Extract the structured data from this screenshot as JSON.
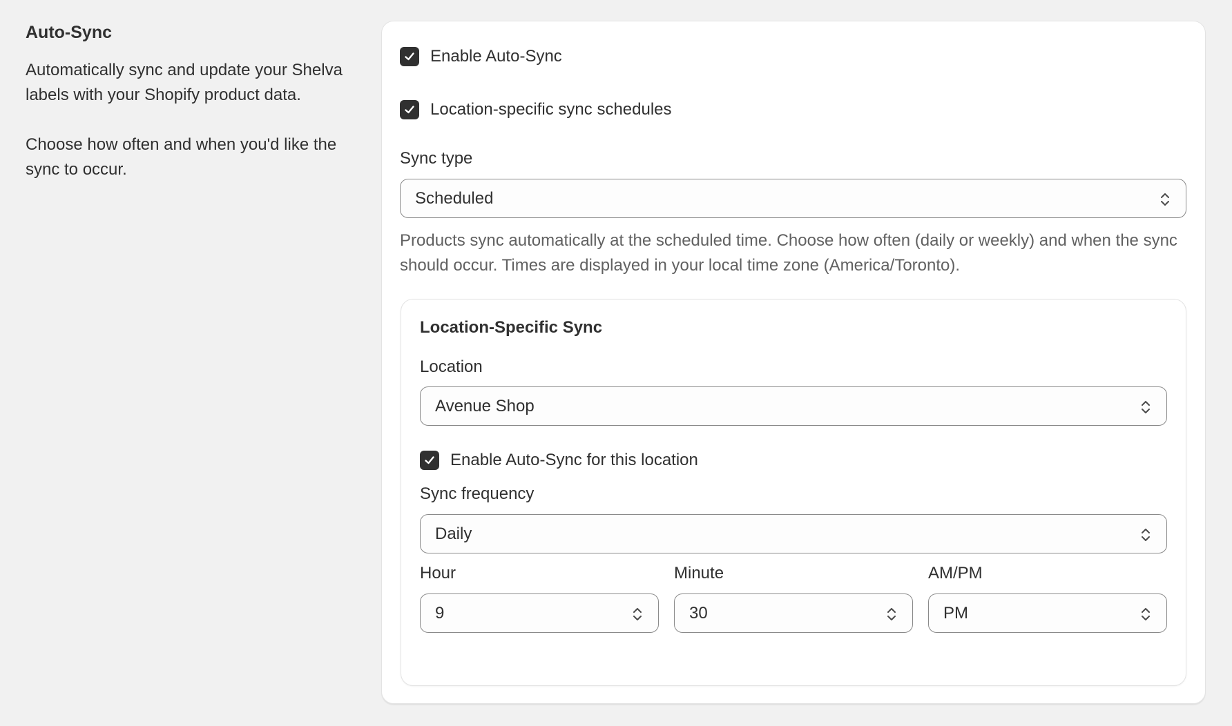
{
  "section": {
    "title": "Auto-Sync",
    "description_1": "Automatically sync and update your Shelva labels with your Shopify product data.",
    "description_2": "Choose how often and when you'd like the sync to occur."
  },
  "settings": {
    "enable_auto_sync": {
      "label": "Enable Auto-Sync",
      "checked": true
    },
    "location_specific": {
      "label": "Location-specific sync schedules",
      "checked": true
    },
    "sync_type": {
      "label": "Sync type",
      "value": "Scheduled",
      "help": "Products sync automatically at the scheduled time. Choose how often (daily or weekly) and when the sync should occur. Times are displayed in your local time zone (America/Toronto)."
    }
  },
  "location_sync": {
    "title": "Location-Specific Sync",
    "location": {
      "label": "Location",
      "value": "Avenue Shop"
    },
    "enable_location": {
      "label": "Enable Auto-Sync for this location",
      "checked": true
    },
    "frequency": {
      "label": "Sync frequency",
      "value": "Daily"
    },
    "hour": {
      "label": "Hour",
      "value": "9"
    },
    "minute": {
      "label": "Minute",
      "value": "30"
    },
    "ampm": {
      "label": "AM/PM",
      "value": "PM"
    }
  },
  "icons": {
    "checkmark": "checkmark-icon",
    "select_arrows": "chevron-up-down-icon"
  },
  "colors": {
    "background": "#f1f1f1",
    "card": "#ffffff",
    "checkbox": "#303030",
    "text": "#303030",
    "help_text": "#616161",
    "input_border": "#8a8a8a"
  }
}
